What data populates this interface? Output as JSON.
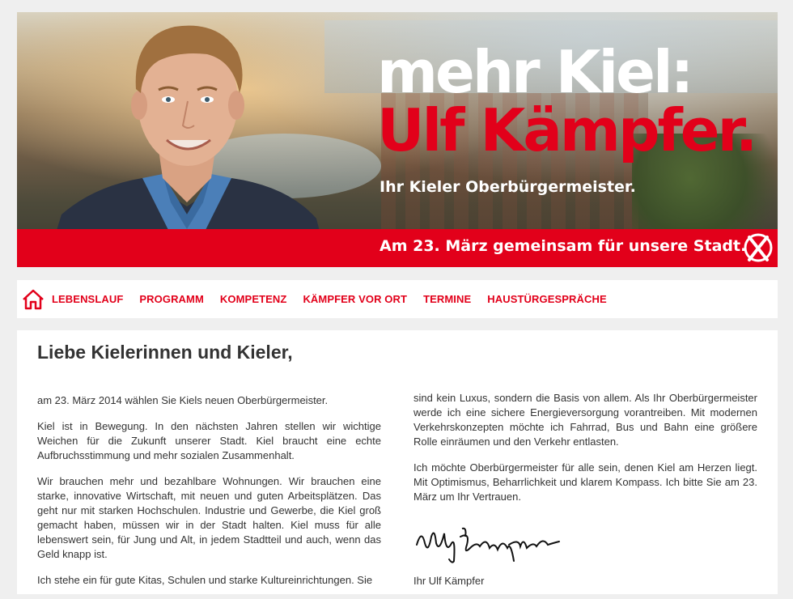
{
  "hero": {
    "headline_line1": "mehr Kiel:",
    "headline_line2": "Ulf Kämpfer.",
    "subtitle": "Ihr Kieler Oberbürgermeister.",
    "date_line": "Am 23. März gemeinsam für unsere Stadt.",
    "colors": {
      "brand_red": "#e2001a",
      "white": "#ffffff"
    }
  },
  "nav": {
    "home_icon": "home-icon",
    "items": [
      {
        "label": "LEBENSLAUF"
      },
      {
        "label": "PROGRAMM"
      },
      {
        "label": "KOMPETENZ"
      },
      {
        "label": "KÄMPFER VOR ORT"
      },
      {
        "label": "TERMINE"
      },
      {
        "label": "HAUSTÜRGESPRÄCHE"
      }
    ]
  },
  "content": {
    "title": "Liebe Kielerinnen und Kieler,",
    "left_paragraphs": [
      "am 23. März 2014 wählen Sie Kiels neuen Oberbürgermeister.",
      "Kiel ist in Bewegung. In den nächsten Jahren stellen wir wichtige Weichen für die Zukunft unserer Stadt. Kiel braucht eine echte Aufbruchsstimmung und mehr sozialen Zusammenhalt.",
      "Wir brauchen mehr und bezahlbare Wohnungen. Wir brauchen eine starke, innovative Wirtschaft, mit neuen und guten Arbeitsplätzen. Das geht nur mit starken Hochschulen. Industrie und Gewerbe, die Kiel groß gemacht haben, müssen wir in der Stadt halten. Kiel muss für alle lebenswert sein, für Jung und Alt, in jedem Stadtteil und auch, wenn das Geld knapp ist.",
      "Ich stehe ein für gute Kitas, Schulen und starke Kultureinrichtungen. Sie"
    ],
    "right_paragraphs": [
      "sind kein Luxus, sondern die Basis von allem. Als Ihr Oberbürgermeister werde ich eine sichere Energieversorgung vorantreiben. Mit modernen Verkehrskonzepten möchte ich Fahrrad, Bus und Bahn eine größere Rolle einräumen und den Verkehr entlasten.",
      "Ich möchte Oberbürgermeister für alle sein, denen Kiel am Herzen liegt. Mit Optimismus, Beharrlichkeit und klarem Kompass. Ich bitte Sie am 23. März um Ihr Vertrauen."
    ],
    "signature_text": "Ulf Kämpfer",
    "closing": "Ihr Ulf Kämpfer"
  }
}
